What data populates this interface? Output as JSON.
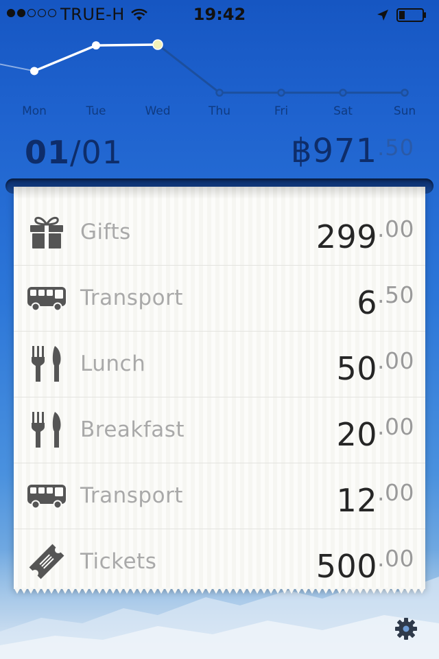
{
  "status_bar": {
    "signal_bars_filled": 2,
    "signal_bars_total": 5,
    "carrier": "TRUE-H",
    "time": "19:42",
    "icons": [
      "wifi-icon",
      "location-arrow-icon",
      "battery-icon"
    ],
    "battery_level": 0.25
  },
  "week_graph": {
    "days": [
      "Mon",
      "Tue",
      "Wed",
      "Thu",
      "Fri",
      "Sat",
      "Sun"
    ],
    "values": [
      300,
      430,
      434,
      190,
      190,
      190,
      190
    ],
    "selected_day": "Wed",
    "colors": {
      "line_past": "#ffffff",
      "line_future": "#1c4f9e",
      "selected_point": "#f3f1b8"
    }
  },
  "summary": {
    "date_day": "01",
    "date_sep": "/",
    "date_month": "01",
    "currency": "฿",
    "total_whole": "971",
    "total_cents": ".50"
  },
  "items": [
    {
      "icon": "gift-icon",
      "label": "Gifts",
      "amount_whole": "299",
      "amount_cents": ".00"
    },
    {
      "icon": "bus-icon",
      "label": "Transport",
      "amount_whole": "6",
      "amount_cents": ".50"
    },
    {
      "icon": "fork-knife-icon",
      "label": "Lunch",
      "amount_whole": "50",
      "amount_cents": ".00"
    },
    {
      "icon": "fork-knife-icon",
      "label": "Breakfast",
      "amount_whole": "20",
      "amount_cents": ".00"
    },
    {
      "icon": "bus-icon",
      "label": "Transport",
      "amount_whole": "12",
      "amount_cents": ".00"
    },
    {
      "icon": "ticket-icon",
      "label": "Tickets",
      "amount_whole": "500",
      "amount_cents": ".00"
    }
  ],
  "footer": {
    "settings_icon": "gear-icon"
  }
}
